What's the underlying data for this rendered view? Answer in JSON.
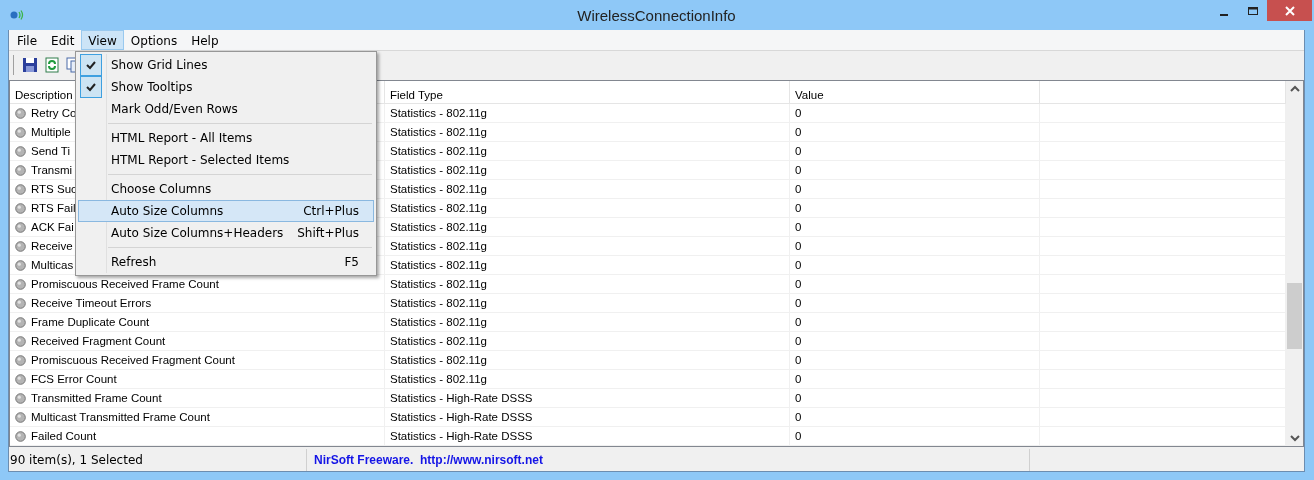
{
  "window": {
    "title": "WirelessConnectionInfo"
  },
  "menu_bar": [
    {
      "label": "File",
      "selected": false
    },
    {
      "label": "Edit",
      "selected": false
    },
    {
      "label": "View",
      "selected": true
    },
    {
      "label": "Options",
      "selected": false
    },
    {
      "label": "Help",
      "selected": false
    }
  ],
  "view_menu": [
    {
      "kind": "check",
      "label": "Show Grid Lines",
      "checked": true,
      "selected": false
    },
    {
      "kind": "check",
      "label": "Show Tooltips",
      "checked": true,
      "selected": false
    },
    {
      "kind": "check",
      "label": "Mark Odd/Even Rows",
      "checked": false,
      "selected": false
    },
    {
      "kind": "separator"
    },
    {
      "kind": "item",
      "label": "HTML Report - All Items",
      "selected": false
    },
    {
      "kind": "item",
      "label": "HTML Report - Selected Items",
      "selected": false
    },
    {
      "kind": "separator"
    },
    {
      "kind": "item",
      "label": "Choose Columns",
      "selected": false
    },
    {
      "kind": "item",
      "label": "Auto Size Columns",
      "shortcut": "Ctrl+Plus",
      "selected": true
    },
    {
      "kind": "item",
      "label": "Auto Size Columns+Headers",
      "shortcut": "Shift+Plus",
      "selected": false
    },
    {
      "kind": "separator"
    },
    {
      "kind": "item",
      "label": "Refresh",
      "shortcut": "F5",
      "selected": false
    }
  ],
  "table": {
    "columns": [
      "Description",
      "Field Type",
      "Value"
    ],
    "rows": [
      [
        "Retry Co",
        "Statistics - 802.11g",
        "0"
      ],
      [
        "Multiple",
        "Statistics - 802.11g",
        "0"
      ],
      [
        "Send Ti",
        "Statistics - 802.11g",
        "0"
      ],
      [
        "Transmi",
        "Statistics - 802.11g",
        "0"
      ],
      [
        "RTS Suc",
        "Statistics - 802.11g",
        "0"
      ],
      [
        "RTS Fail",
        "Statistics - 802.11g",
        "0"
      ],
      [
        "ACK Fai",
        "Statistics - 802.11g",
        "0"
      ],
      [
        "Receive",
        "Statistics - 802.11g",
        "0"
      ],
      [
        "Multicas",
        "Statistics - 802.11g",
        "0"
      ],
      [
        "Promiscuous Received Frame Count",
        "Statistics - 802.11g",
        "0"
      ],
      [
        "Receive Timeout Errors",
        "Statistics - 802.11g",
        "0"
      ],
      [
        "Frame Duplicate Count",
        "Statistics - 802.11g",
        "0"
      ],
      [
        "Received Fragment Count",
        "Statistics - 802.11g",
        "0"
      ],
      [
        "Promiscuous Received Fragment Count",
        "Statistics - 802.11g",
        "0"
      ],
      [
        "FCS Error Count",
        "Statistics - 802.11g",
        "0"
      ],
      [
        "Transmitted Frame Count",
        "Statistics - High-Rate DSSS",
        "0"
      ],
      [
        "Multicast Transmitted Frame Count",
        "Statistics - High-Rate DSSS",
        "0"
      ],
      [
        "Failed Count",
        "Statistics - High-Rate DSSS",
        "0"
      ]
    ]
  },
  "status_bar": {
    "count": "90 item(s), 1 Selected",
    "credit": "NirSoft Freeware.  http://www.nirsoft.net"
  }
}
